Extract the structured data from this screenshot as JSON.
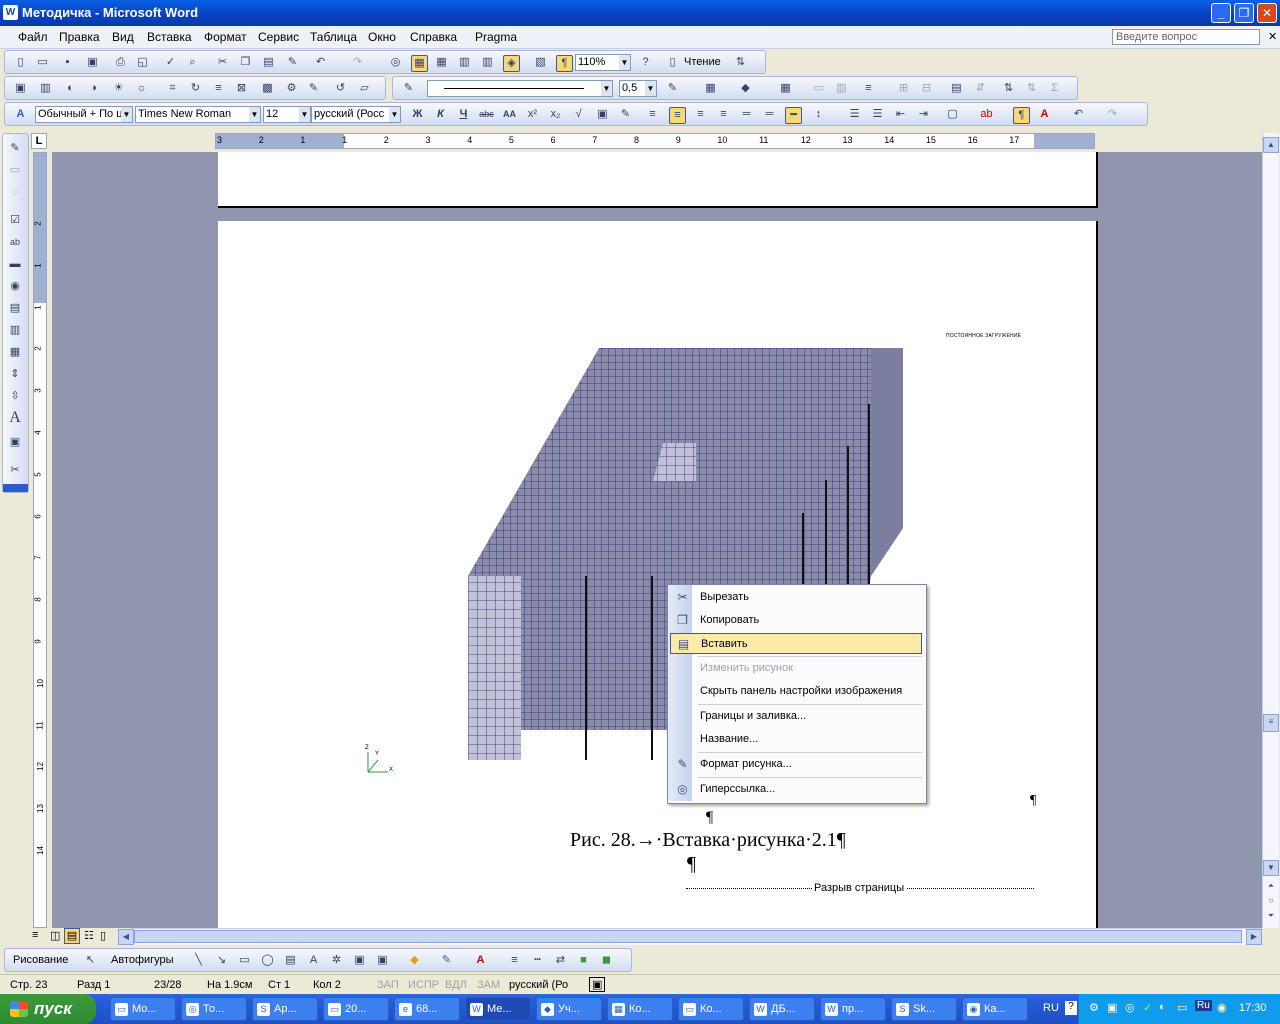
{
  "window": {
    "title": "Методичка - Microsoft Word",
    "icon": "word-icon"
  },
  "menu": {
    "items": [
      "Файл",
      "Правка",
      "Вид",
      "Вставка",
      "Формат",
      "Сервис",
      "Таблица",
      "Окно",
      "Справка",
      "Pragma"
    ],
    "ask_placeholder": "Введите вопрос"
  },
  "toolbar_standard": {
    "zoom": "110%",
    "reading_label": "Чтение"
  },
  "toolbar_drawing_top": {
    "line_weight": "0,5"
  },
  "toolbar_format": {
    "style": "Обычный + По ц",
    "font": "Times New Roman",
    "size": "12",
    "language": "русский (Росс"
  },
  "ruler": {
    "h_labels": [
      "3",
      "2",
      "1",
      "1",
      "2",
      "3",
      "4",
      "5",
      "6",
      "7",
      "8",
      "9",
      "10",
      "11",
      "12",
      "13",
      "14",
      "15",
      "16",
      "17"
    ],
    "v_labels": [
      "2",
      "1",
      "1",
      "2",
      "3",
      "4",
      "5",
      "6",
      "7",
      "8",
      "9",
      "10",
      "11",
      "12",
      "13",
      "14"
    ]
  },
  "document": {
    "image_caption_small": "ПОСТОЯННОЕ ЗАГРУЖЕНИЕ",
    "axis_labels": {
      "z": "Z",
      "y": "Y",
      "x": "X"
    },
    "pilcrow": "¶",
    "figure_caption": "Рис. 28.→·Вставка·рисунка·2.1¶",
    "page_break": "Разрыв страницы"
  },
  "context_menu": {
    "items": [
      {
        "label": "Вырезать",
        "icon": "scissors-icon",
        "enabled": true
      },
      {
        "label": "Копировать",
        "icon": "copy-icon",
        "enabled": true
      },
      {
        "label": "Вставить",
        "icon": "paste-icon",
        "enabled": true,
        "highlighted": true
      },
      {
        "label": "Изменить рисунок",
        "icon": "",
        "enabled": false
      },
      {
        "label": "Скрыть панель настройки изображения",
        "icon": "",
        "enabled": true
      },
      {
        "label": "Границы и заливка...",
        "icon": "",
        "enabled": true
      },
      {
        "label": "Название...",
        "icon": "",
        "enabled": true
      },
      {
        "label": "Формат рисунка...",
        "icon": "format-picture-icon",
        "enabled": true
      },
      {
        "label": "Гиперссылка...",
        "icon": "hyperlink-icon",
        "enabled": true
      }
    ]
  },
  "draw_bar": {
    "drawing": "Рисование",
    "autoshapes": "Автофигуры"
  },
  "status": {
    "page": "Стр. 23",
    "section": "Разд 1",
    "pages": "23/28",
    "at": "На 1.9см",
    "line": "Ст 1",
    "col": "Кол 2",
    "rec": "ЗАП",
    "trk": "ИСПР",
    "ext": "ВДЛ",
    "ovr": "ЗАМ",
    "language": "русский (Ро"
  },
  "taskbar": {
    "start": "пуск",
    "tasks": [
      "Мо...",
      "То...",
      "Ар...",
      "20...",
      "68...",
      "Ме...",
      "Уч...",
      "Ко...",
      "Ко...",
      "ДБ...",
      "пр...",
      "Sk...",
      "Ка..."
    ],
    "lang": "RU",
    "time": "17:30"
  }
}
